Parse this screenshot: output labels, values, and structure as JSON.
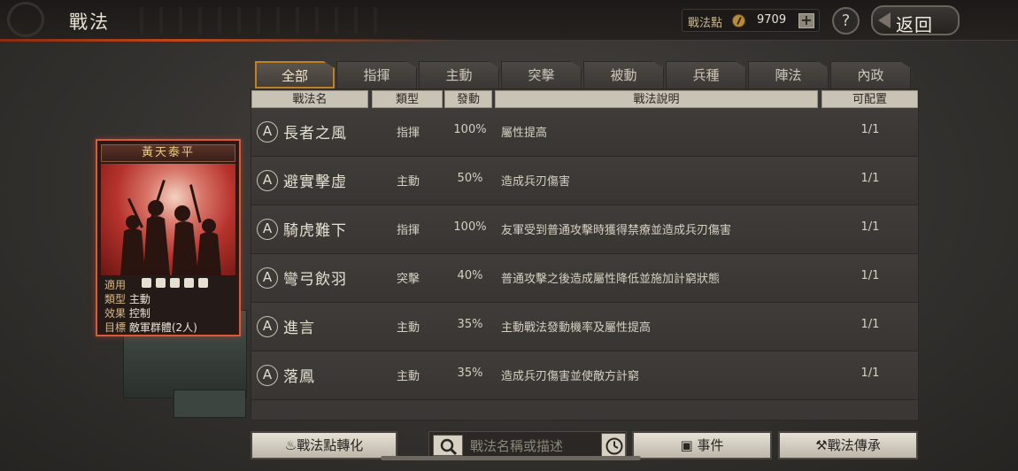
{
  "header": {
    "title": "戰法",
    "points_label": "戰法點",
    "points_value": "9709",
    "plus": "+",
    "help": "?",
    "back": "返回"
  },
  "tabs": [
    "全部",
    "指揮",
    "主動",
    "突擊",
    "被動",
    "兵種",
    "陣法",
    "內政"
  ],
  "active_tab": "全部",
  "columns": [
    "戰法名",
    "類型",
    "發動",
    "戰法說明",
    "可配置"
  ],
  "rows": [
    {
      "grade": "A",
      "name": "長者之風",
      "type": "指揮",
      "rate": "100%",
      "desc": "屬性提高",
      "slots": "1/1"
    },
    {
      "grade": "A",
      "name": "避實擊虛",
      "type": "主動",
      "rate": "50%",
      "desc": "造成兵刃傷害",
      "slots": "1/1"
    },
    {
      "grade": "A",
      "name": "騎虎難下",
      "type": "指揮",
      "rate": "100%",
      "desc": "友軍受到普通攻擊時獲得禁療並造成兵刃傷害",
      "slots": "1/1"
    },
    {
      "grade": "A",
      "name": "彎弓飲羽",
      "type": "突擊",
      "rate": "40%",
      "desc": "普通攻擊之後造成屬性降低並施加計窮狀態",
      "slots": "1/1"
    },
    {
      "grade": "A",
      "name": "進言",
      "type": "主動",
      "rate": "35%",
      "desc": "主動戰法發動機率及屬性提高",
      "slots": "1/1"
    },
    {
      "grade": "A",
      "name": "落鳳",
      "type": "主動",
      "rate": "35%",
      "desc": "造成兵刃傷害並使敵方計窮",
      "slots": "1/1"
    }
  ],
  "card": {
    "title": "黃天泰平",
    "apply_label": "適用",
    "type_label": "類型",
    "type_value": "主動",
    "effect_label": "效果",
    "effect_value": "控制",
    "target_label": "目標",
    "target_value": "敵軍群體(2人)"
  },
  "bottom": {
    "convert": "戰法點轉化",
    "search_placeholder": "戰法名稱或描述",
    "events": "事件",
    "inherit": "戰法傳承"
  },
  "colors": {
    "accent": "#c08024",
    "card_border": "#d85a3c"
  }
}
